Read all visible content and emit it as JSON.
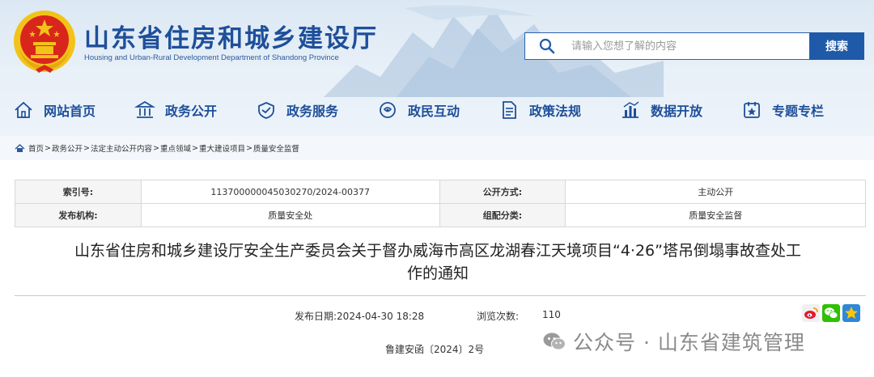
{
  "header": {
    "title": "山东省住房和城乡建设厅",
    "subtitle": "Housing and Urban-Rural Development Department of Shandong Province",
    "colors": {
      "brand": "#1e4f9a",
      "accent": "#1f5aa8",
      "emblem_red": "#d9261c",
      "emblem_gold": "#f2c318"
    }
  },
  "search": {
    "placeholder": "请输入您想了解的内容",
    "button_label": "搜索",
    "icon": "search-icon"
  },
  "nav": {
    "items": [
      {
        "label": "网站首页",
        "icon": "home-icon"
      },
      {
        "label": "政务公开",
        "icon": "government-building-icon"
      },
      {
        "label": "政务服务",
        "icon": "service-icon"
      },
      {
        "label": "政民互动",
        "icon": "interaction-icon"
      },
      {
        "label": "政策法规",
        "icon": "document-icon"
      },
      {
        "label": "数据开放",
        "icon": "chart-icon"
      },
      {
        "label": "专题专栏",
        "icon": "topic-icon"
      }
    ]
  },
  "breadcrumb": {
    "items": [
      "首页",
      "政务公开",
      "法定主动公开内容",
      "重点领域",
      "重大建设项目",
      "质量安全监督"
    ],
    "separator": ">"
  },
  "meta": {
    "rows": [
      {
        "k1": "索引号:",
        "v1": "113700000045030270/2024-00377",
        "k2": "公开方式:",
        "v2": "主动公开"
      },
      {
        "k1": "发布机构:",
        "v1": "质量安全处",
        "k2": "组配分类:",
        "v2": "质量安全监督"
      }
    ]
  },
  "article": {
    "title_line1": "山东省住房和城乡建设厅安全生产委员会关于督办威海市高区龙湖春江天境项目“4·26”塔吊倒塌事故查处工",
    "title_line2": "作的通知",
    "publish_date": "发布日期:2024-04-30 18:28",
    "views_label": "浏览次数:",
    "views_count": "110",
    "doc_number": "鲁建安函〔2024〕2号",
    "share": [
      "weibo-icon",
      "wechat-icon",
      "qzone-icon"
    ]
  },
  "watermark": {
    "text": "公众号 · 山东省建筑管理",
    "icon": "wechat-logo-icon"
  }
}
